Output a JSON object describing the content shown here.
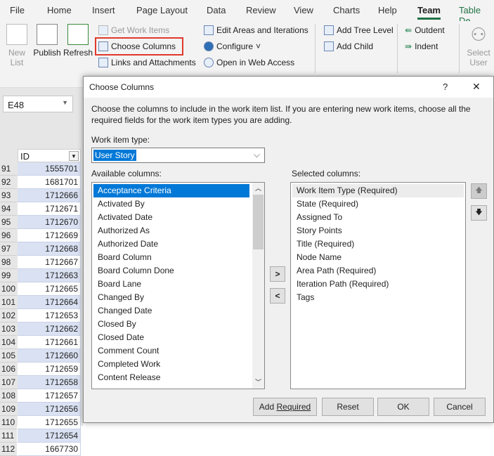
{
  "menu": {
    "tabs": [
      "File",
      "Home",
      "Insert",
      "Page Layout",
      "Data",
      "Review",
      "View",
      "Charts",
      "Help",
      "Team",
      "Table De"
    ],
    "active": "Team"
  },
  "ribbon": {
    "new_list": "New List",
    "publish": "Publish",
    "refresh": "Refresh",
    "get_work_items": "Get Work Items",
    "choose_columns": "Choose Columns",
    "links_attachments": "Links and Attachments",
    "edit_areas": "Edit Areas and Iterations",
    "configure": "Configure",
    "open_web": "Open in Web Access",
    "add_tree_level": "Add Tree Level",
    "add_child": "Add Child",
    "outdent": "Outdent",
    "indent": "Indent",
    "select_user": "Select User"
  },
  "sheet": {
    "name_box": "E48",
    "column_header": "ID",
    "rows": [
      {
        "n": "91",
        "id": "1555701"
      },
      {
        "n": "92",
        "id": "1681701"
      },
      {
        "n": "93",
        "id": "1712666"
      },
      {
        "n": "94",
        "id": "1712671"
      },
      {
        "n": "95",
        "id": "1712670"
      },
      {
        "n": "96",
        "id": "1712669"
      },
      {
        "n": "97",
        "id": "1712668"
      },
      {
        "n": "98",
        "id": "1712667"
      },
      {
        "n": "99",
        "id": "1712663"
      },
      {
        "n": "100",
        "id": "1712665"
      },
      {
        "n": "101",
        "id": "1712664"
      },
      {
        "n": "102",
        "id": "1712653"
      },
      {
        "n": "103",
        "id": "1712662"
      },
      {
        "n": "104",
        "id": "1712661"
      },
      {
        "n": "105",
        "id": "1712660"
      },
      {
        "n": "106",
        "id": "1712659"
      },
      {
        "n": "107",
        "id": "1712658"
      },
      {
        "n": "108",
        "id": "1712657"
      },
      {
        "n": "109",
        "id": "1712656"
      },
      {
        "n": "110",
        "id": "1712655"
      },
      {
        "n": "111",
        "id": "1712654"
      },
      {
        "n": "112",
        "id": "1667730"
      }
    ]
  },
  "dialog": {
    "title": "Choose Columns",
    "help": "?",
    "close": "✕",
    "description": "Choose the columns to include in the work item list.  If you are entering new work items, choose all the required fields for the work item types you are adding.",
    "work_item_type_label": "Work item type:",
    "work_item_type_value": "User Story",
    "available_label": "Available columns:",
    "selected_label": "Selected columns:",
    "available": [
      "Acceptance Criteria",
      "Activated By",
      "Activated Date",
      "Authorized As",
      "Authorized Date",
      "Board Column",
      "Board Column Done",
      "Board Lane",
      "Changed By",
      "Changed Date",
      "Closed By",
      "Closed Date",
      "Comment Count",
      "Completed Work",
      "Content Release"
    ],
    "selected": [
      "Work Item Type (Required)",
      "State (Required)",
      "Assigned To",
      "Story Points",
      "Title (Required)",
      "Node Name",
      "Area Path (Required)",
      "Iteration Path (Required)",
      "Tags"
    ],
    "buttons": {
      "add": ">",
      "remove": "<",
      "up": "🡅",
      "down": "🡇",
      "add_required": "Add Required",
      "reset": "Reset",
      "ok": "OK",
      "cancel": "Cancel"
    }
  },
  "colors": {
    "accent": "#0078d7",
    "team_tab": "#217346",
    "highlight": "#e0392b"
  }
}
